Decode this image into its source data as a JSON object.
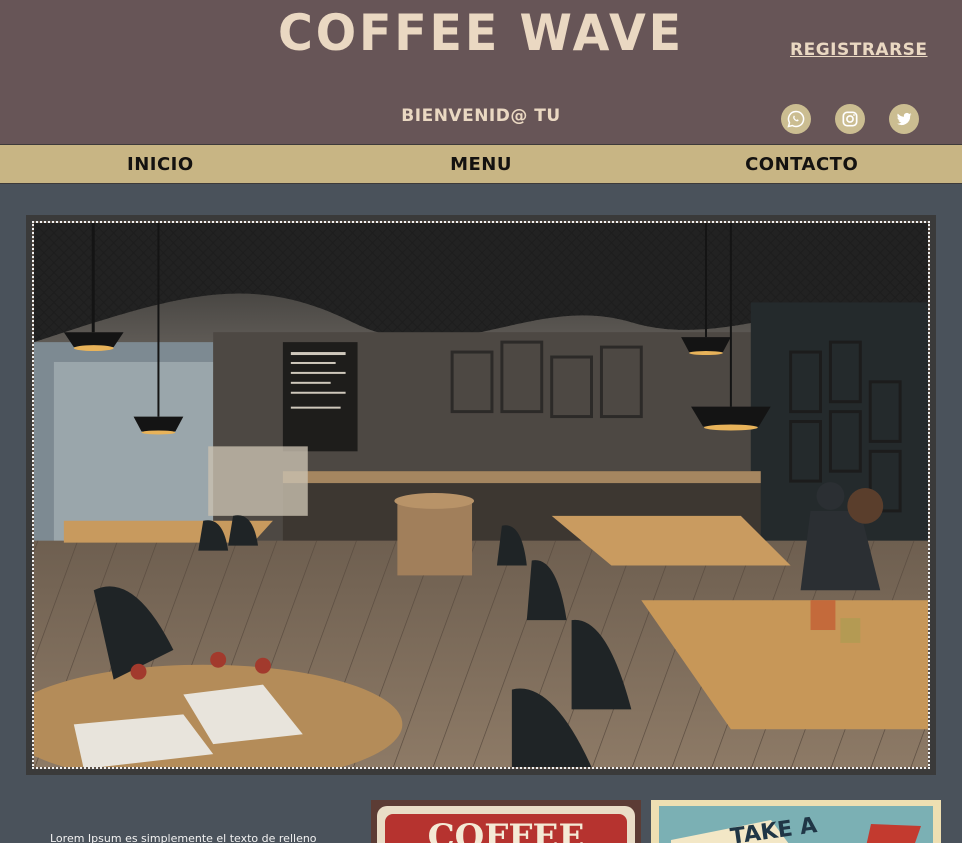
{
  "header": {
    "brand": "COFFEE WAVE",
    "register_label": "REGISTRARSE",
    "welcome": "BIENVENID@ TU",
    "social": [
      "whatsapp-icon",
      "instagram-icon",
      "twitter-icon"
    ]
  },
  "nav": {
    "items": [
      {
        "label": "INICIO"
      },
      {
        "label": "MENU"
      },
      {
        "label": "CONTACTO"
      }
    ]
  },
  "content": {
    "lorem": "Lorem Ipsum es simplemente el texto de relleno",
    "poster1_text": "COFFEE",
    "poster2_text": "TAKE A"
  },
  "colors": {
    "header_bg": "#675557",
    "nav_bg": "#c8b584",
    "page_bg": "#4a525b",
    "brand_text": "#ead8c2"
  }
}
